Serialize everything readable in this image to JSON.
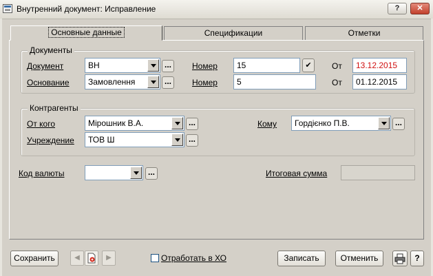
{
  "window": {
    "title": "Внутренний документ: Исправление",
    "help_label": "?",
    "close_label": "✕"
  },
  "tabs": [
    {
      "label": "Основные данные",
      "active": true
    },
    {
      "label": "Спецификации",
      "active": false
    },
    {
      "label": "Отметки",
      "active": false
    }
  ],
  "documents": {
    "group_label": "Документы",
    "document_label": "Документ",
    "document_value": "ВН",
    "basis_label": "Основание",
    "basis_value": "Замовлення",
    "number_label": "Номер",
    "number_value": "15",
    "number2_label": "Номер",
    "number2_value": "5",
    "from_label": "От",
    "from_value": "13.12.2015",
    "from2_label": "От",
    "from2_value": "01.12.2015"
  },
  "contractors": {
    "group_label": "Контрагенты",
    "from_whom_label": "От кого",
    "from_whom_value": "Мірошник В.А.",
    "institution_label": "Учреждение",
    "institution_value": "ТОВ Ш",
    "to_whom_label": "Кому",
    "to_whom_value": "Гордієнко П.В."
  },
  "currency": {
    "label": "Код валюты",
    "value": ""
  },
  "total": {
    "label": "Итоговая сумма",
    "value": ""
  },
  "footer": {
    "save_label": "Сохранить",
    "process_label": "Отработать в ХО",
    "process_checked": false,
    "record_label": "Записать",
    "cancel_label": "Отменить",
    "help_label": "?"
  },
  "colors": {
    "date_highlight": "#d01010"
  }
}
